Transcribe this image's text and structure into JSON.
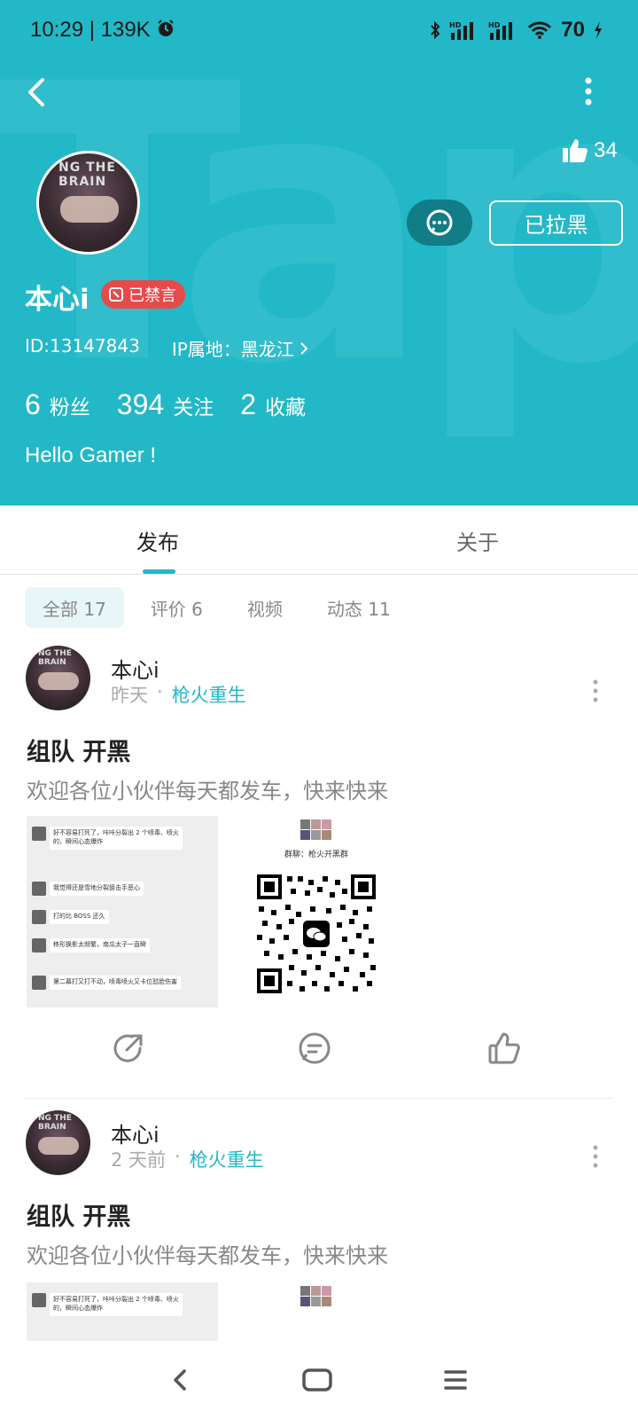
{
  "status_bar": {
    "time": "10:29",
    "speed": "139K",
    "battery": "70"
  },
  "profile": {
    "watermark": "TapTap",
    "likes": "34",
    "username": "本心i",
    "muted_label": "已禁言",
    "id_text": "ID:13147843",
    "ip_text": "IP属地：黑龙江",
    "block_label": "已拉黑",
    "bio": "Hello Gamer !",
    "stats": [
      {
        "num": "6",
        "label": "粉丝"
      },
      {
        "num": "394",
        "label": "关注"
      },
      {
        "num": "2",
        "label": "收藏"
      }
    ]
  },
  "tabs": [
    {
      "label": "发布"
    },
    {
      "label": "关于"
    }
  ],
  "filters": [
    {
      "label": "全部 17"
    },
    {
      "label": "评价 6"
    },
    {
      "label": "视频"
    },
    {
      "label": "动态 11"
    }
  ],
  "posts": [
    {
      "author": "本心i",
      "time": "昨天",
      "game": "枪火重生",
      "title": "组队 开黑",
      "body": "欢迎各位小伙伴每天都发车，快来快来",
      "qr_label": "群聊：枪火开黑群",
      "chat": [
        "好不容易打死了，咔咔分裂出 2 个喷毒、喷火的，瞬间心态爆炸",
        "我觉得还是雪地分裂狙击手恶心",
        "打的比 BOSS 还久",
        "移形换影太频繁，南瓜太子一直瞬",
        "第二幕打又打不动，喷毒喷火又卡位怼脸伤害"
      ]
    },
    {
      "author": "本心i",
      "time": "2 天前",
      "game": "枪火重生",
      "title": "组队 开黑",
      "body": "欢迎各位小伙伴每天都发车，快来快来",
      "chat": [
        "好不容易打死了，咔咔分裂出 2 个喷毒、喷火的，瞬间心态爆炸"
      ]
    }
  ],
  "colors": {
    "accent": "#22b8c7",
    "header_bg": "#22b8c7",
    "muted_badge": "#e64a4a",
    "message_btn": "#117d87"
  }
}
